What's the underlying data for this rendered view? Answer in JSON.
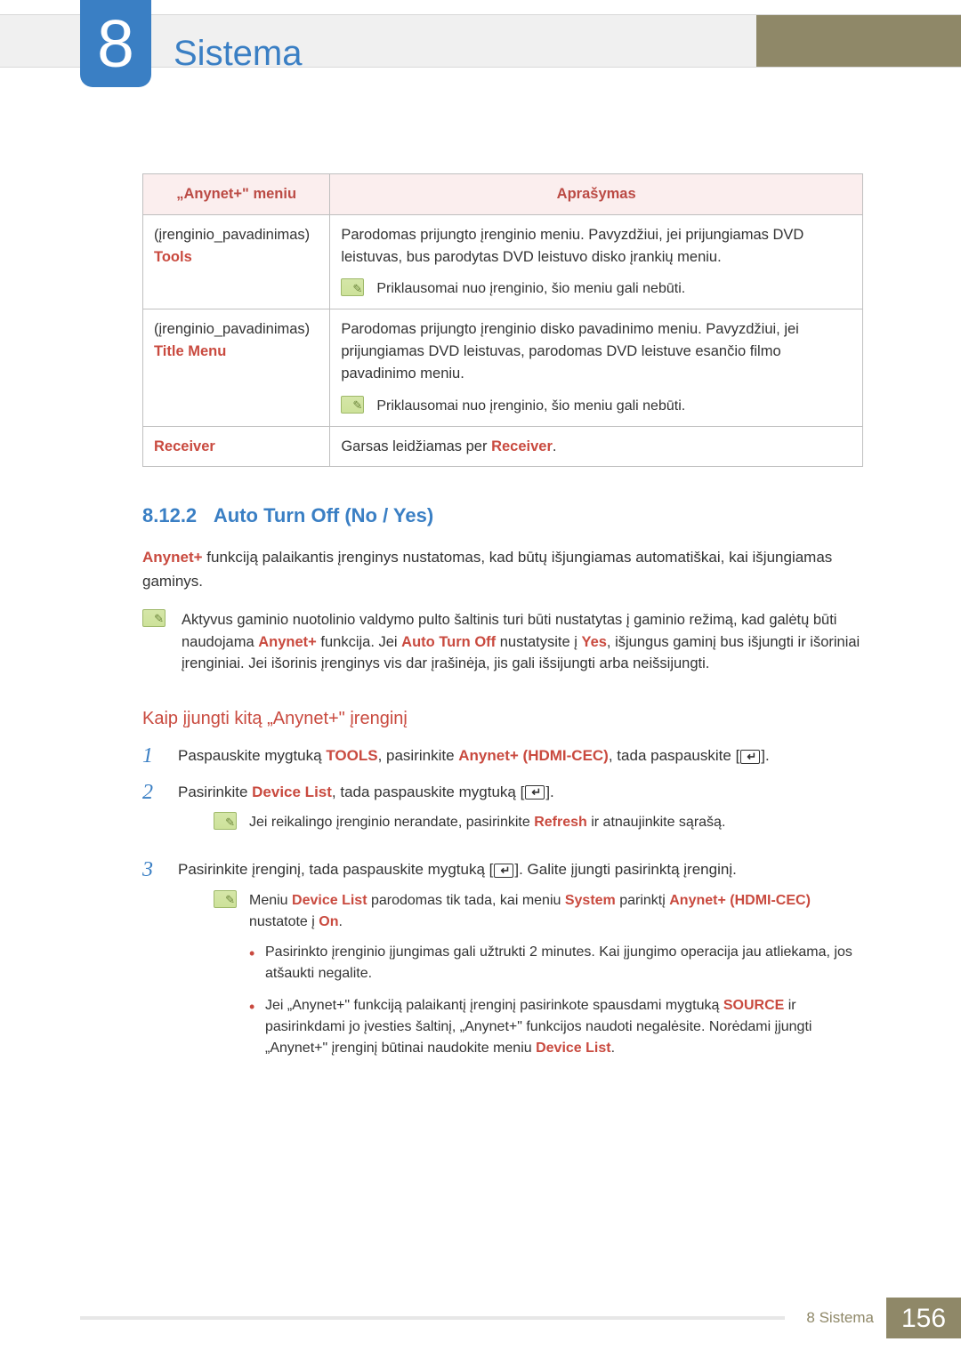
{
  "chapter": {
    "number": "8",
    "title": "Sistema"
  },
  "table": {
    "header": {
      "col1": "„Anynet+\" meniu",
      "col2": "Aprašymas"
    },
    "rows": [
      {
        "left_prefix": "(įrenginio_pavadinimas)",
        "left_label": "Tools",
        "desc": "Parodomas prijungto įrenginio meniu. Pavyzdžiui, jei prijungiamas DVD leistuvas, bus parodytas DVD leistuvo disko įrankių meniu.",
        "note": "Priklausomai nuo įrenginio, šio meniu gali nebūti."
      },
      {
        "left_prefix": "(įrenginio_pavadinimas)",
        "left_label": "Title Menu",
        "desc": "Parodomas prijungto įrenginio disko pavadinimo meniu. Pavyzdžiui, jei prijungiamas DVD leistuvas, parodomas DVD leistuve esančio filmo pavadinimo meniu.",
        "note": "Priklausomai nuo įrenginio, šio meniu gali nebūti."
      },
      {
        "left_prefix": "",
        "left_label": "Receiver",
        "desc_prefix": "Garsas leidžiamas per ",
        "desc_red": "Receiver",
        "desc_suffix": "."
      }
    ]
  },
  "section": {
    "number": "8.12.2",
    "title": "Auto Turn Off (No / Yes)",
    "body_prefix_red": "Anynet+",
    "body_after": " funkciją palaikantis įrenginys nustatomas, kad būtų išjungiamas automatiškai, kai išjungiamas gaminys."
  },
  "info_note": {
    "p1a": "Aktyvus gaminio nuotolinio valdymo pulto šaltinis turi būti nustatytas į gaminio režimą, kad galėtų būti naudojama ",
    "p1_red1": "Anynet+",
    "p1b": " funkcija. Jei ",
    "p1_red2": "Auto Turn Off",
    "p1c": " nustatysite į ",
    "p1_red3": "Yes",
    "p1d": ", išjungus gaminį bus išjungti ir išoriniai įrenginiai. Jei išorinis įrenginys vis dar įrašinėja, jis gali išsijungti arba neišsijungti."
  },
  "subsection": {
    "heading": "Kaip įjungti kitą „Anynet+\" įrenginį"
  },
  "steps": {
    "s1": {
      "a": "Paspauskite mygtuką ",
      "b_red": "TOOLS",
      "c": ", pasirinkite ",
      "d_red": "Anynet+ (HDMI-CEC)",
      "e": ", tada paspauskite [",
      "f": "]."
    },
    "s2": {
      "a": "Pasirinkite ",
      "b_red": "Device List",
      "c": ", tada paspauskite mygtuką [",
      "d": "].",
      "note_a": "Jei reikalingo įrenginio nerandate, pasirinkite ",
      "note_red": "Refresh",
      "note_b": " ir atnaujinkite sąrašą."
    },
    "s3": {
      "a": "Pasirinkite įrenginį, tada paspauskite mygtuką [",
      "b": "]. Galite įjungti pasirinktą įrenginį.",
      "note_a": "Meniu ",
      "note_red1": "Device List",
      "note_b": " parodomas tik tada, kai meniu ",
      "note_red2": "System",
      "note_c": " parinktį ",
      "note_red3": "Anynet+ (HDMI-CEC)",
      "note_d": " nustatote į ",
      "note_red4": "On",
      "note_e": ".",
      "bullets": [
        {
          "t": "Pasirinkto įrenginio įjungimas gali užtrukti 2 minutes. Kai įjungimo operacija jau atliekama, jos atšaukti negalite."
        },
        {
          "a": "Jei „Anynet+\" funkciją palaikantį įrenginį pasirinkote spausdami mygtuką ",
          "red1": "SOURCE",
          "b": " ir pasirinkdami jo įvesties šaltinį, „Anynet+\" funkcijos naudoti negalėsite. Norėdami įjungti „Anynet+\" įrenginį būtinai naudokite meniu ",
          "red2": "Device List",
          "c": "."
        }
      ]
    }
  },
  "footer": {
    "chapter": "8 Sistema",
    "page": "156"
  }
}
